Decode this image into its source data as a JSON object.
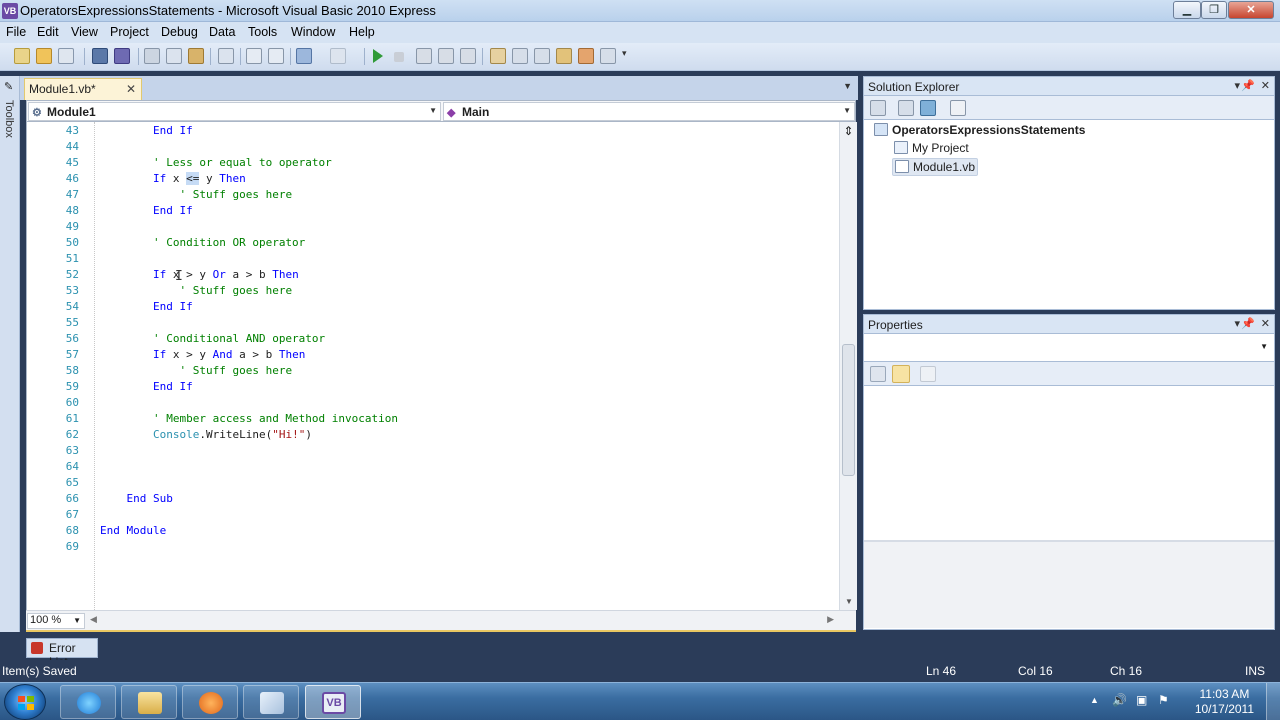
{
  "window": {
    "title": "OperatorsExpressionsStatements - Microsoft Visual Basic 2010 Express",
    "app_icon": "VB"
  },
  "menu": [
    "File",
    "Edit",
    "View",
    "Project",
    "Debug",
    "Data",
    "Tools",
    "Window",
    "Help"
  ],
  "toolbox_label": "Toolbox",
  "doc_tab": {
    "label": "Module1.vb*",
    "close": "✕"
  },
  "nav": {
    "left": "Module1",
    "right": "Main"
  },
  "code_lines": [
    {
      "n": "43",
      "parts": [
        {
          "t": "        ",
          "c": ""
        },
        {
          "t": "End If",
          "c": "kw"
        }
      ]
    },
    {
      "n": "44",
      "parts": []
    },
    {
      "n": "45",
      "parts": [
        {
          "t": "        ",
          "c": ""
        },
        {
          "t": "' Less or equal to operator",
          "c": "cm"
        }
      ]
    },
    {
      "n": "46",
      "parts": [
        {
          "t": "        ",
          "c": ""
        },
        {
          "t": "If",
          "c": "kw"
        },
        {
          "t": " x ",
          "c": ""
        },
        {
          "t": "<=",
          "c": "hl"
        },
        {
          "t": " y ",
          "c": ""
        },
        {
          "t": "Then",
          "c": "kw"
        }
      ]
    },
    {
      "n": "47",
      "parts": [
        {
          "t": "            ",
          "c": ""
        },
        {
          "t": "' Stuff goes here",
          "c": "cm"
        }
      ]
    },
    {
      "n": "48",
      "parts": [
        {
          "t": "        ",
          "c": ""
        },
        {
          "t": "End If",
          "c": "kw"
        }
      ]
    },
    {
      "n": "49",
      "parts": []
    },
    {
      "n": "50",
      "parts": [
        {
          "t": "        ",
          "c": ""
        },
        {
          "t": "' Condition OR operator",
          "c": "cm"
        }
      ]
    },
    {
      "n": "51",
      "parts": []
    },
    {
      "n": "52",
      "parts": [
        {
          "t": "        ",
          "c": ""
        },
        {
          "t": "If",
          "c": "kw"
        },
        {
          "t": " x > y ",
          "c": ""
        },
        {
          "t": "Or",
          "c": "kw"
        },
        {
          "t": " a > b ",
          "c": ""
        },
        {
          "t": "Then",
          "c": "kw"
        }
      ]
    },
    {
      "n": "53",
      "parts": [
        {
          "t": "            ",
          "c": ""
        },
        {
          "t": "' Stuff goes here",
          "c": "cm"
        }
      ]
    },
    {
      "n": "54",
      "parts": [
        {
          "t": "        ",
          "c": ""
        },
        {
          "t": "End If",
          "c": "kw"
        }
      ]
    },
    {
      "n": "55",
      "parts": []
    },
    {
      "n": "56",
      "parts": [
        {
          "t": "        ",
          "c": ""
        },
        {
          "t": "' Conditional AND operator",
          "c": "cm"
        }
      ]
    },
    {
      "n": "57",
      "parts": [
        {
          "t": "        ",
          "c": ""
        },
        {
          "t": "If",
          "c": "kw"
        },
        {
          "t": " x > y ",
          "c": ""
        },
        {
          "t": "And",
          "c": "kw"
        },
        {
          "t": " a > b ",
          "c": ""
        },
        {
          "t": "Then",
          "c": "kw"
        }
      ]
    },
    {
      "n": "58",
      "parts": [
        {
          "t": "            ",
          "c": ""
        },
        {
          "t": "' Stuff goes here",
          "c": "cm"
        }
      ]
    },
    {
      "n": "59",
      "parts": [
        {
          "t": "        ",
          "c": ""
        },
        {
          "t": "End If",
          "c": "kw"
        }
      ]
    },
    {
      "n": "60",
      "parts": []
    },
    {
      "n": "61",
      "parts": [
        {
          "t": "        ",
          "c": ""
        },
        {
          "t": "' Member access and Method invocation",
          "c": "cm"
        }
      ]
    },
    {
      "n": "62",
      "parts": [
        {
          "t": "        ",
          "c": ""
        },
        {
          "t": "Console",
          "c": "ty"
        },
        {
          "t": ".WriteLine(",
          "c": ""
        },
        {
          "t": "\"Hi!\"",
          "c": "st"
        },
        {
          "t": ")",
          "c": ""
        }
      ]
    },
    {
      "n": "63",
      "parts": []
    },
    {
      "n": "64",
      "parts": []
    },
    {
      "n": "65",
      "parts": []
    },
    {
      "n": "66",
      "parts": [
        {
          "t": "    ",
          "c": ""
        },
        {
          "t": "End Sub",
          "c": "kw"
        }
      ]
    },
    {
      "n": "67",
      "parts": []
    },
    {
      "n": "68",
      "parts": [
        {
          "t": "End Module",
          "c": "kw"
        }
      ]
    },
    {
      "n": "69",
      "parts": []
    }
  ],
  "zoom": "100 %",
  "solution_explorer": {
    "title": "Solution Explorer",
    "project": "OperatorsExpressionsStatements",
    "items": [
      "My Project",
      "Module1.vb"
    ]
  },
  "properties": {
    "title": "Properties"
  },
  "error_list": "Error List",
  "status": {
    "message": "Item(s) Saved",
    "ln": "Ln 46",
    "col": "Col 16",
    "ch": "Ch 16",
    "ins": "INS"
  },
  "clock": {
    "time": "11:03 AM",
    "date": "10/17/2011"
  },
  "colors": {
    "accent": "#2b3c59",
    "keyword": "#0000ff",
    "comment": "#008000",
    "type": "#2b91af",
    "string": "#a31515"
  }
}
